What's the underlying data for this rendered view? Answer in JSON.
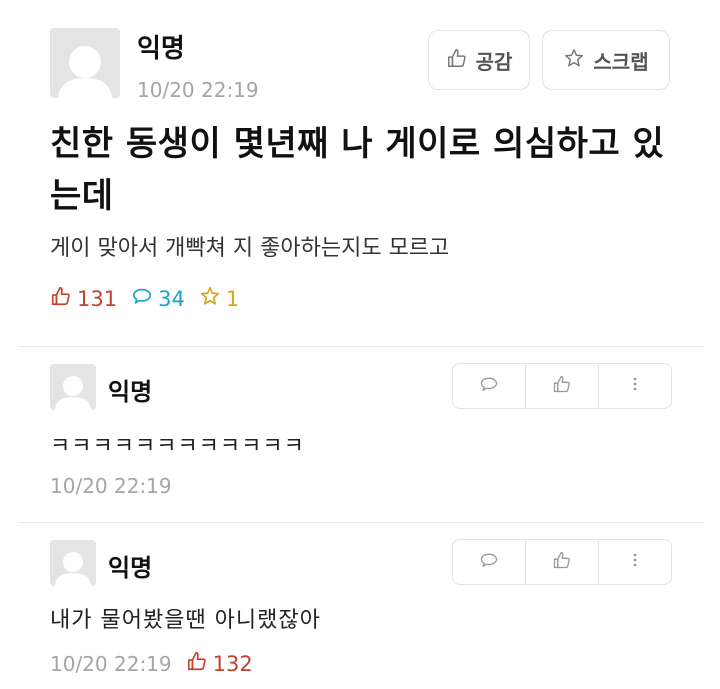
{
  "post": {
    "author": "익명",
    "timestamp": "10/20 22:19",
    "like_button": "공감",
    "scrap_button": "스크랩",
    "title": "친한 동생이 몇년째 나 게이로 의심하고 있는데",
    "body": "게이 맞아서 개빡쳐 지 좋아하는지도 모르고",
    "stats": {
      "likes": "131",
      "comments": "34",
      "scraps": "1"
    },
    "colors": {
      "like": "#c6402e",
      "comment": "#1aa3c8",
      "scrap": "#d6a51a"
    }
  },
  "comments": [
    {
      "author": "익명",
      "text": "ㅋㅋㅋㅋㅋㅋㅋㅋㅋㅋㅋㅋ",
      "timestamp": "10/20 22:19",
      "likes": ""
    },
    {
      "author": "익명",
      "text": "내가 물어봤을땐 아니랬잖아",
      "timestamp": "10/20 22:19",
      "likes": "132"
    }
  ],
  "icons": {
    "avatar": "avatar-icon",
    "like": "thumbs-up-icon",
    "scrap": "star-icon",
    "comment": "speech-bubble-icon",
    "more": "more-vertical-icon"
  }
}
